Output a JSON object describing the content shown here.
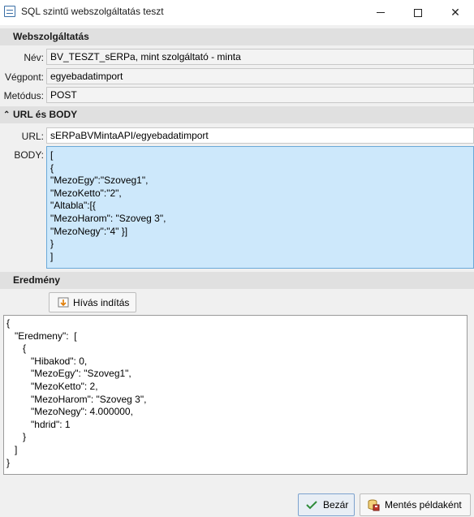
{
  "window": {
    "title": "SQL szintű webszolgáltatás teszt"
  },
  "sections": {
    "webservice": "Webszolgáltatás",
    "url_body": "URL és BODY",
    "result": "Eredmény"
  },
  "webservice": {
    "name_label": "Név:",
    "name_value": "BV_TESZT_sERPa, mint szolgáltató - minta",
    "endpoint_label": "Végpont:",
    "endpoint_value": "egyebadatimport",
    "method_label": "Metódus:",
    "method_value": "POST"
  },
  "request": {
    "url_label": "URL:",
    "url_value": "sERPaBVMintaAPI/egyebadatimport",
    "body_label": "BODY:",
    "body_value": "[\n{\n\"MezoEgy\":\"Szoveg1\",\n\"MezoKetto\":\"2\",\n\"Altabla\":[{\n\"MezoHarom\": \"Szoveg 3\",\n\"MezoNegy\":\"4\" }]\n}\n]"
  },
  "call_button": "Hívás indítás",
  "result_text": "{\n   \"Eredmeny\":  [\n      {\n         \"Hibakod\": 0,\n         \"MezoEgy\": \"Szoveg1\",\n         \"MezoKetto\": 2,\n         \"MezoHarom\": \"Szoveg 3\",\n         \"MezoNegy\": 4.000000,\n         \"hdrid\": 1\n      }\n   ]\n}",
  "buttons": {
    "close": "Bezár",
    "save_example": "Mentés példaként"
  },
  "colors": {
    "section_bg": "#e0e0e0",
    "body_bg": "#cde8fb",
    "body_border": "#6aa9d8"
  }
}
